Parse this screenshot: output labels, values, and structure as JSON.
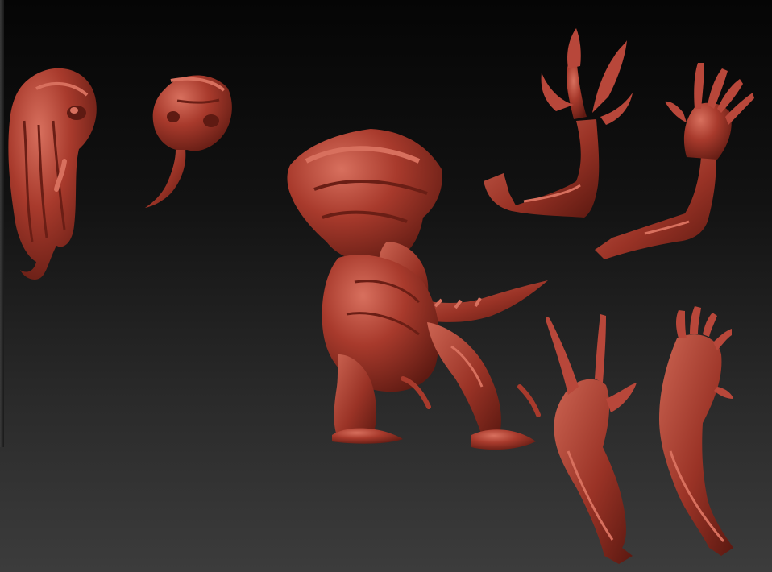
{
  "scene": {
    "subject": "sculpt-parts",
    "material_color": "#a83a2c",
    "material_highlight": "#d8705e",
    "material_shadow": "#5e1a12",
    "background_top": "#050505",
    "background_bottom": "#3c3c3c"
  },
  "parts": [
    {
      "name": "head-variant-tentacle-face"
    },
    {
      "name": "head-variant-tongue"
    },
    {
      "name": "creature-body"
    },
    {
      "name": "arm-claw-upper"
    },
    {
      "name": "arm-hand-upper"
    },
    {
      "name": "arm-claw-lower"
    },
    {
      "name": "arm-hand-lower"
    }
  ]
}
